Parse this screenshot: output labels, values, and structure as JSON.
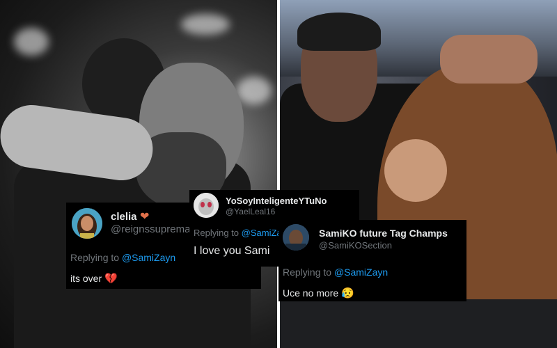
{
  "tweets": [
    {
      "name": "clelia",
      "badge": "heart-emoji",
      "badge_glyph": "❤",
      "handle": "@reignssuprema",
      "replying_prefix": "Replying to ",
      "replying_to": "@SamiZayn",
      "text": "its over ",
      "emoji": "💔"
    },
    {
      "name": "YoSoyInteligenteYTuNo",
      "handle": "@YaelLeal16",
      "replying_prefix": "Replying to ",
      "replying_to": "@SamiZayn",
      "text": "I love you Sami"
    },
    {
      "name": "SamiKO future Tag Champs",
      "handle": "@SamiKOSection",
      "replying_prefix": "Replying to ",
      "replying_to": "@SamiZayn",
      "text": "Uce no more ",
      "emoji": "😥"
    }
  ],
  "colors": {
    "card_bg": "#000000",
    "text_primary": "#e7e9ea",
    "text_secondary": "#71767b",
    "mention": "#1d9bf0"
  }
}
